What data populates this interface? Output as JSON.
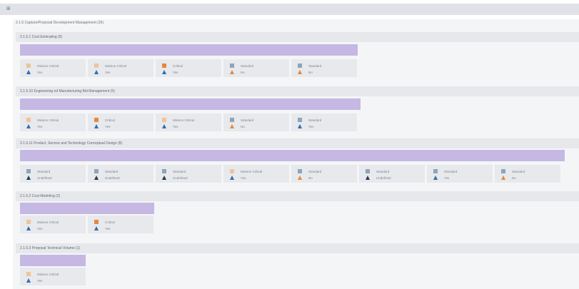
{
  "colors": {
    "mission_critical": "#f0c39c",
    "critical": "#e8873b",
    "standard": "#8ca5b9",
    "tri_blue": "#2f6fae",
    "tri_orange": "#e8873b",
    "tri_dark": "#233b56",
    "bar": "#c5b8e3"
  },
  "topbar": {
    "icon": "grid-icon",
    "label": ""
  },
  "root": {
    "title": "2.1.5 Capture/Proposal Development Management (26)"
  },
  "groups": [
    {
      "title": "2.1.5.1 Cost Estimating (5)",
      "cards": [
        {
          "level": "Mission Critical",
          "answer": "Yes"
        },
        {
          "level": "Mission Critical",
          "answer": "Yes"
        },
        {
          "level": "Critical",
          "answer": "Yes"
        },
        {
          "level": "Standard",
          "answer": "No"
        },
        {
          "level": "Standard",
          "answer": "No"
        }
      ]
    },
    {
      "title": "2.1.5.10 Engineering nd Manufacturing Bid Management (5)",
      "cards": [
        {
          "level": "Mission Critical",
          "answer": "Yes"
        },
        {
          "level": "Critical",
          "answer": "Yes"
        },
        {
          "level": "Mission Critical",
          "answer": "Yes"
        },
        {
          "level": "Standard",
          "answer": "No"
        },
        {
          "level": "Standard",
          "answer": "Yes"
        }
      ]
    },
    {
      "title": "2.1.5.11 Product, Service and Technology Conceptual Design (8)",
      "cards": [
        {
          "level": "Standard",
          "answer": "Undefined"
        },
        {
          "level": "Standard",
          "answer": "Undefined"
        },
        {
          "level": "Standard",
          "answer": "Undefined"
        },
        {
          "level": "Mission Critical",
          "answer": "Yes"
        },
        {
          "level": "Standard",
          "answer": "No"
        },
        {
          "level": "Standard",
          "answer": "Undefined"
        },
        {
          "level": "Standard",
          "answer": "Yes"
        },
        {
          "level": "Standard",
          "answer": "No"
        }
      ]
    },
    {
      "title": "2.1.5.2 Cost Modeling (2)",
      "cards": [
        {
          "level": "Mission Critical",
          "answer": "Yes"
        },
        {
          "level": "Critical",
          "answer": "Yes"
        }
      ]
    },
    {
      "title": "2.1.5.3 Proposal Technical Volume (1)",
      "cards": [
        {
          "level": "Mission Critical",
          "answer": "Yes"
        }
      ]
    }
  ]
}
